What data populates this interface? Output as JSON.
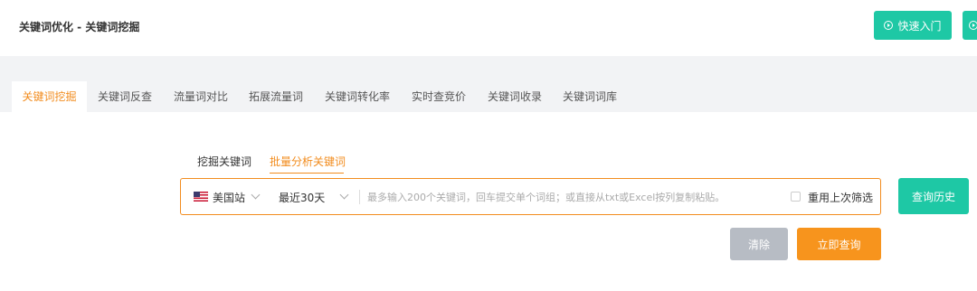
{
  "header": {
    "title": "关键词优化 - 关键词挖掘",
    "quick_entry_label": "快速入门"
  },
  "tabs": [
    {
      "label": "关键词挖掘",
      "active": true
    },
    {
      "label": "关键词反查"
    },
    {
      "label": "流量词对比"
    },
    {
      "label": "拓展流量词"
    },
    {
      "label": "关键词转化率"
    },
    {
      "label": "实时查竞价"
    },
    {
      "label": "关键词收录"
    },
    {
      "label": "关键词词库"
    }
  ],
  "subtabs": [
    {
      "label": "挖掘关键词"
    },
    {
      "label": "批量分析关键词",
      "active": true
    }
  ],
  "search": {
    "site": "美国站",
    "period": "最近30天",
    "placeholder": "最多输入200个关键词，回车提交单个词组；或直接从txt或Excel按列复制粘贴。",
    "value": "",
    "reuse_filter_label": "重用上次筛选",
    "reuse_filter_checked": false
  },
  "buttons": {
    "history": "查询历史",
    "clear": "清除",
    "query_now": "立即查询"
  },
  "colors": {
    "accent_orange": "#f28c1e",
    "accent_teal": "#1ec8a5",
    "clear_gray": "#b7bcc4"
  }
}
